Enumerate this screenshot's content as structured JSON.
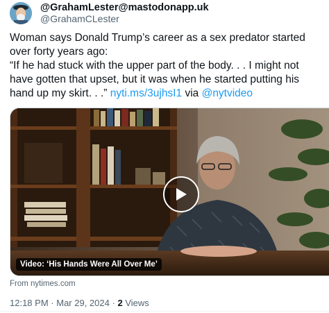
{
  "author": {
    "display_name": "@GrahamLester@mastodonapp.uk",
    "handle": "@GrahamCLester"
  },
  "tweet": {
    "text_line1": "Woman says Donald Trump’s career as a sex predator started over forty years ago:",
    "text_quote": "“If he had stuck with the upper part of the body. . . I might not have gotten that upset, but it was when he started putting his hand up my skirt. . .”",
    "link_url": "nyti.ms/3ujhsI1",
    "via_word": "via",
    "via_handle": "@nytvideo"
  },
  "media": {
    "caption": "Video: ‘His Hands Were All Over Me’",
    "play_icon": "play-icon"
  },
  "source_label": "From nytimes.com",
  "meta": {
    "time": "12:18 PM",
    "separator": "·",
    "date": "Mar 29, 2024",
    "views_count": "2",
    "views_label": "Views"
  }
}
